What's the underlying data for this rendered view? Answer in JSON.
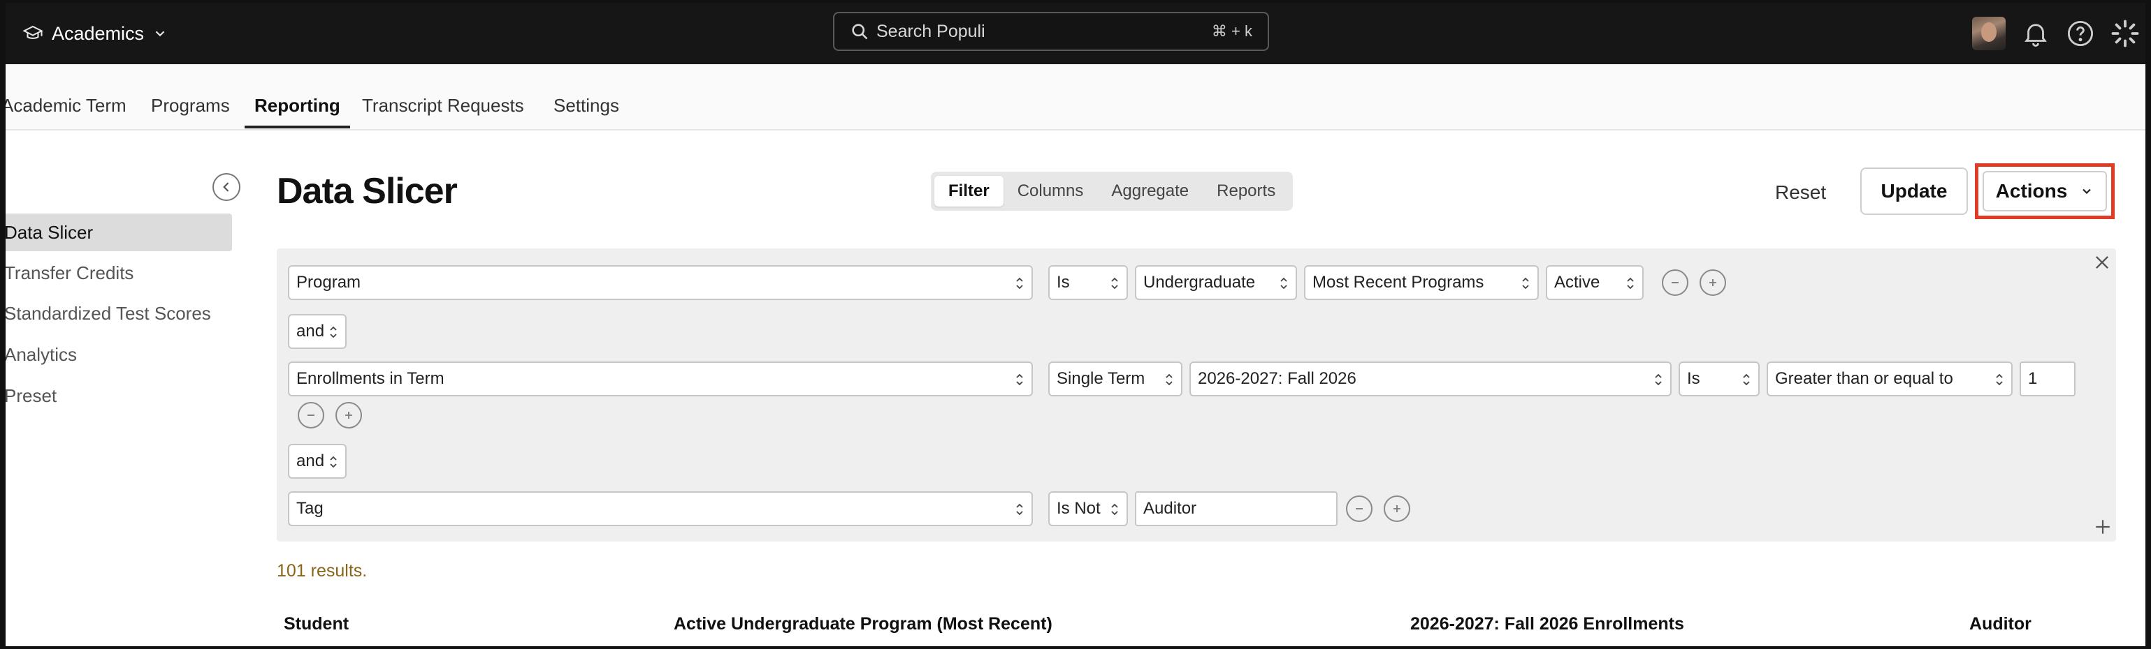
{
  "topbar": {
    "brand": "Academics",
    "search_placeholder": "Search Populi",
    "search_shortcut": "⌘ + k"
  },
  "nav_tabs": [
    "Academic Term",
    "Programs",
    "Reporting",
    "Transcript Requests",
    "Settings"
  ],
  "nav_active": "Reporting",
  "sidebar": {
    "items": [
      "Data Slicer",
      "Transfer Credits",
      "Standardized Test Scores",
      "Analytics",
      "Preset"
    ]
  },
  "header": {
    "title": "Data Slicer",
    "segments": [
      "Filter",
      "Columns",
      "Aggregate",
      "Reports"
    ],
    "reset": "Reset",
    "update": "Update",
    "actions": "Actions"
  },
  "filters": {
    "row1": {
      "field": "Program",
      "op": "Is",
      "value": "Undergraduate",
      "scope": "Most Recent Programs",
      "status": "Active"
    },
    "conj1": "and",
    "row2": {
      "field": "Enrollments in Term",
      "mode": "Single Term",
      "term": "2026-2027: Fall 2026",
      "op": "Is",
      "compare": "Greater than or equal to",
      "number": "1"
    },
    "conj2": "and",
    "row3": {
      "field": "Tag",
      "op": "Is Not",
      "value": "Auditor"
    }
  },
  "results": "101 results.",
  "table": {
    "columns": [
      "Student",
      "Active Undergraduate Program (Most Recent)",
      "2026-2027: Fall 2026 Enrollments",
      "Auditor"
    ]
  },
  "colors": {
    "accent_red": "#e03b24",
    "topbar": "#161616",
    "results_text": "#8a6418"
  },
  "icons": [
    "graduation-cap-icon",
    "chevron-down-icon",
    "search-icon",
    "bell-icon",
    "help-icon",
    "loading-spinner-icon",
    "chevron-left-icon",
    "close-icon",
    "plus-icon",
    "minus-icon"
  ]
}
